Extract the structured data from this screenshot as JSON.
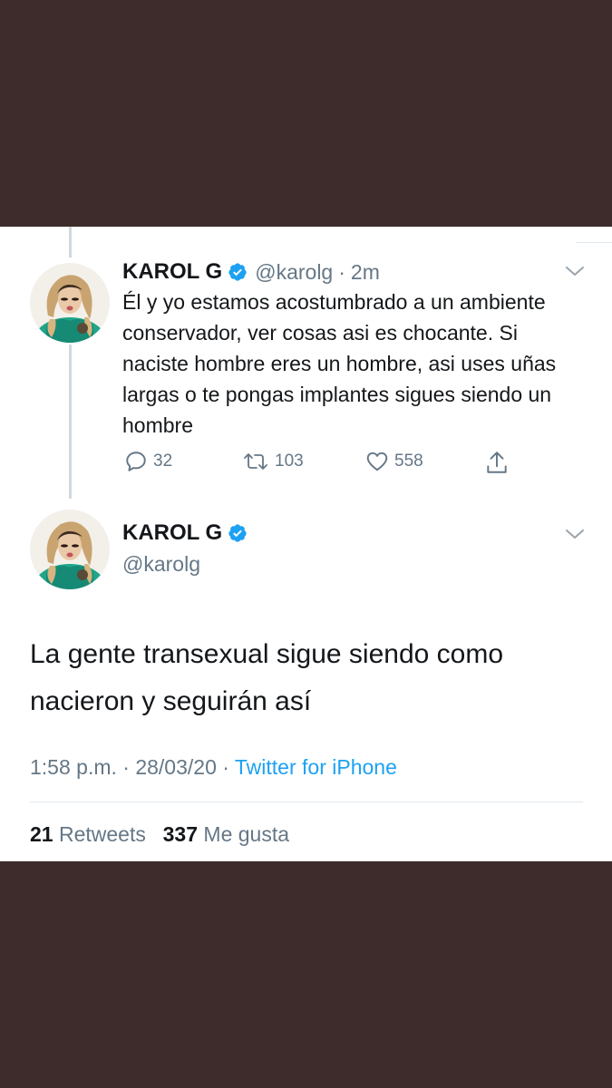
{
  "colors": {
    "background": "#3d2c2b",
    "accent": "#1da1f2",
    "verified_badge": "#1da1f2",
    "secondary_text": "#657786"
  },
  "tweet1": {
    "name": "KAROL G",
    "verified": true,
    "handle": "@karolg",
    "time": "2m",
    "text": "Él y yo estamos acostumbrado a un ambiente conservador, ver cosas asi es chocante. Si naciste hombre eres un hombre, asi uses uñas largas o te pongas implantes sigues siendo un hombre",
    "actions": {
      "reply_count": "32",
      "retweet_count": "103",
      "like_count": "558"
    },
    "icons": [
      "reply-icon",
      "retweet-icon",
      "like-icon",
      "share-icon",
      "chevron-down-icon",
      "verified-icon"
    ]
  },
  "tweet2": {
    "name": "KAROL G",
    "verified": true,
    "handle": "@karolg",
    "text": "La gente transexual sigue siendo como nacieron y seguirán así",
    "timestamp": "1:58 p.m. · 28/03/20",
    "separator": "·",
    "source": "Twitter for iPhone",
    "retweets_count": "21",
    "retweets_label": "Retweets",
    "likes_count": "337",
    "likes_label": "Me gusta"
  }
}
